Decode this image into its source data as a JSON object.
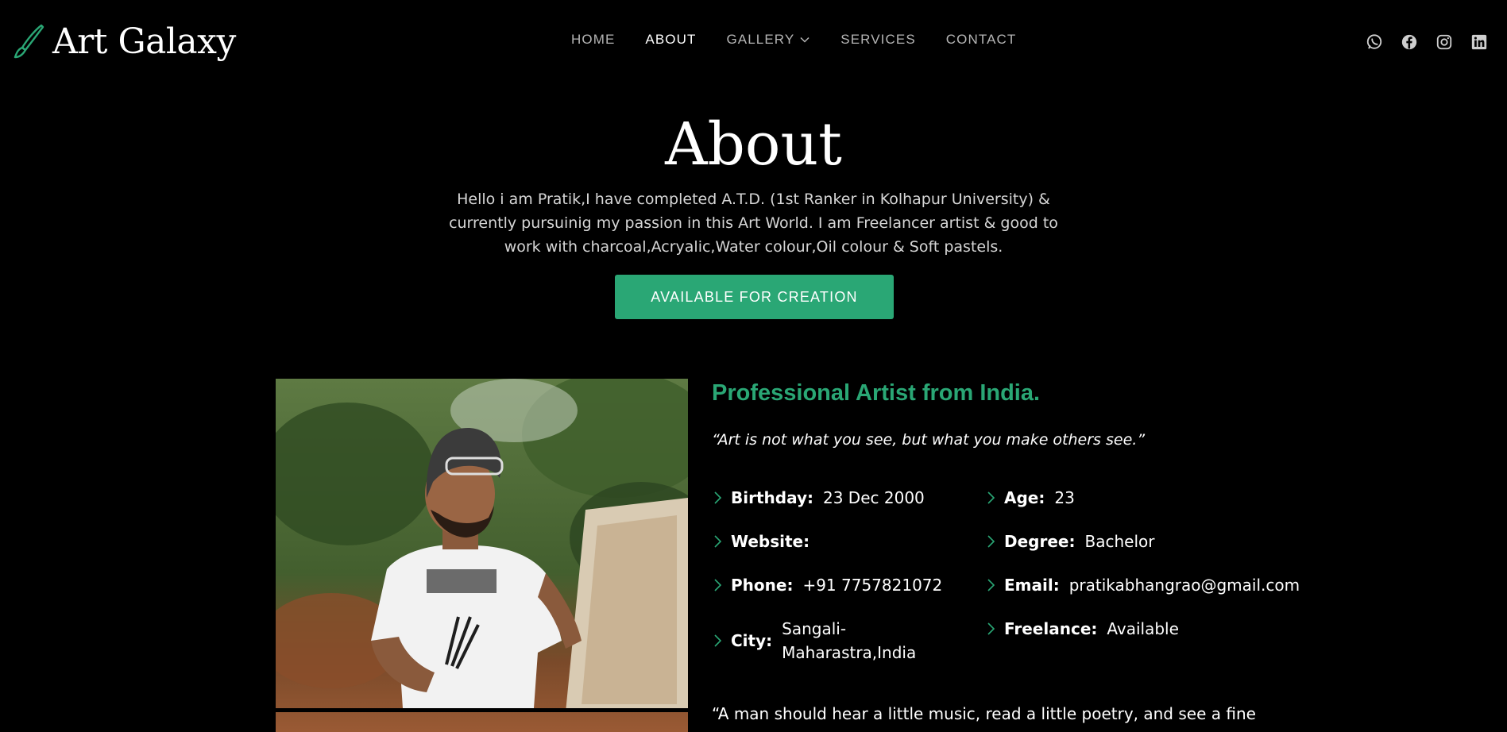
{
  "brand": {
    "name": "Art Galaxy",
    "icon": "paintbrush-icon",
    "accent": "#2aa775"
  },
  "nav": {
    "items": [
      {
        "label": "HOME",
        "active": false
      },
      {
        "label": "ABOUT",
        "active": true
      },
      {
        "label": "GALLERY",
        "active": false,
        "has_dropdown": true
      },
      {
        "label": "SERVICES",
        "active": false
      },
      {
        "label": "CONTACT",
        "active": false
      }
    ]
  },
  "social": [
    "whatsapp-icon",
    "facebook-icon",
    "instagram-icon",
    "linkedin-icon"
  ],
  "hero": {
    "title": "About",
    "text": "Hello i am Pratik,I have completed A.T.D. (1st Ranker in Kolhapur University) & currently pursuinig my passion in this Art World. I am Freelancer artist & good to work with charcoal,Acryalic,Water colour,Oil colour & Soft pastels.",
    "cta": "AVAILABLE FOR CREATION"
  },
  "profile": {
    "title": "Professional Artist from India.",
    "quote": "“Art is not what you see, but what you make others see.”",
    "fields": [
      {
        "key": "Birthday:",
        "value": "23 Dec 2000"
      },
      {
        "key": "Age:",
        "value": "23"
      },
      {
        "key": "Website:",
        "value": ""
      },
      {
        "key": "Degree:",
        "value": "Bachelor"
      },
      {
        "key": "Phone:",
        "value": "+91 7757821072"
      },
      {
        "key": "Email:",
        "value": "pratikabhangrao@gmail.com"
      },
      {
        "key": "City:",
        "value": "Sangali-\nMaharastra,India"
      },
      {
        "key": "Freelance:",
        "value": "Available"
      }
    ],
    "bottom_quote": "“A man should hear a little music, read a little poetry, and see a fine"
  }
}
